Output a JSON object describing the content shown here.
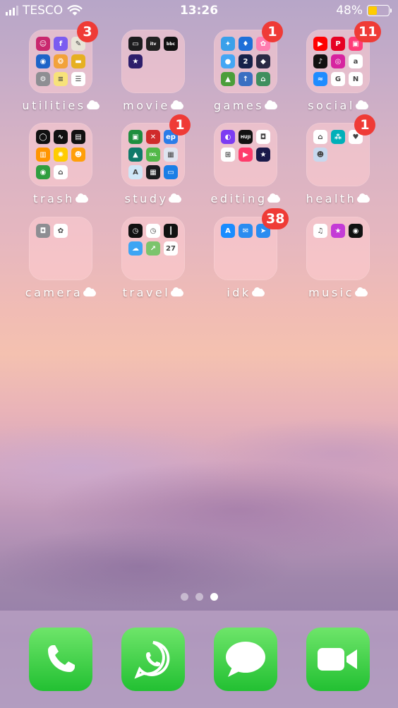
{
  "status": {
    "carrier": "TESCO",
    "time": "13:26",
    "battery": "48%",
    "battery_level": 0.48
  },
  "folders": [
    {
      "label": "utilities",
      "badge": "3",
      "apps": [
        {
          "icon": "santa-icon",
          "bg": "#c9286e",
          "glyph": "☺"
        },
        {
          "icon": "fonts-icon",
          "bg": "#7b5cf0",
          "glyph": "f"
        },
        {
          "icon": "notes-pencil-icon",
          "bg": "#e8e4d8",
          "glyph": "✎"
        },
        {
          "icon": "ring-icon",
          "bg": "#1e64c8",
          "glyph": "◉"
        },
        {
          "icon": "fontmaker-icon",
          "bg": "#f2a23a",
          "glyph": "❂"
        },
        {
          "icon": "wallet-gold-icon",
          "bg": "#e6b022",
          "glyph": "▬"
        },
        {
          "icon": "settings-icon",
          "bg": "#8e8e93",
          "glyph": "⚙"
        },
        {
          "icon": "notes-icon",
          "bg": "#f7e27a",
          "glyph": "≡"
        },
        {
          "icon": "reminders-icon",
          "bg": "#ffffff",
          "glyph": "☰"
        }
      ]
    },
    {
      "label": "movie",
      "badge": "",
      "apps": [
        {
          "icon": "tv-icon",
          "bg": "#1c1c1e",
          "glyph": "▭"
        },
        {
          "icon": "itv-icon",
          "bg": "#222222",
          "glyph": "itv"
        },
        {
          "icon": "bbc-iplayer-icon",
          "bg": "#111111",
          "glyph": "bbc"
        },
        {
          "icon": "imovie-icon",
          "bg": "#2d1e6b",
          "glyph": "★"
        }
      ]
    },
    {
      "label": "games",
      "badge": "1",
      "apps": [
        {
          "icon": "sky-game-icon",
          "bg": "#3aa0ea",
          "glyph": "✦"
        },
        {
          "icon": "game-blue-icon",
          "bg": "#1f6fd8",
          "glyph": "♦"
        },
        {
          "icon": "game-pink-icon",
          "bg": "#ff7db0",
          "glyph": "✿"
        },
        {
          "icon": "balloon-game-icon",
          "bg": "#45a6f4",
          "glyph": "●"
        },
        {
          "icon": "piano-tiles-icon",
          "bg": "#15224a",
          "glyph": "2"
        },
        {
          "icon": "cube-game-icon",
          "bg": "#2a2a44",
          "glyph": "◆"
        },
        {
          "icon": "temple-game-icon",
          "bg": "#4b9e3a",
          "glyph": "▲"
        },
        {
          "icon": "road-game-icon",
          "bg": "#3a6fc2",
          "glyph": "↑"
        },
        {
          "icon": "house-game-icon",
          "bg": "#3f8f5e",
          "glyph": "⌂"
        }
      ]
    },
    {
      "label": "social",
      "badge": "11",
      "apps": [
        {
          "icon": "youtube-icon",
          "bg": "#ff0000",
          "glyph": "▶"
        },
        {
          "icon": "pinterest-icon",
          "bg": "#e60023",
          "glyph": "P"
        },
        {
          "icon": "pink-app-icon",
          "bg": "#ff3c78",
          "glyph": "▣"
        },
        {
          "icon": "tiktok-icon",
          "bg": "#111111",
          "glyph": "♪"
        },
        {
          "icon": "instagram-icon",
          "bg": "#d6249f",
          "glyph": "◎"
        },
        {
          "icon": "amazon-icon",
          "bg": "#ffffff",
          "glyph": "a"
        },
        {
          "icon": "messenger-icon",
          "bg": "#1f8cff",
          "glyph": "≈"
        },
        {
          "icon": "google-icon",
          "bg": "#ffffff",
          "glyph": "G"
        },
        {
          "icon": "news-icon",
          "bg": "#ffffff",
          "glyph": "N"
        }
      ]
    },
    {
      "label": "trash",
      "badge": "",
      "apps": [
        {
          "icon": "watch-icon",
          "bg": "#111111",
          "glyph": "◯"
        },
        {
          "icon": "stocks-icon",
          "bg": "#111111",
          "glyph": "∿"
        },
        {
          "icon": "wallet-icon",
          "bg": "#111111",
          "glyph": "▤"
        },
        {
          "icon": "books-icon",
          "bg": "#ff9500",
          "glyph": "▥"
        },
        {
          "icon": "tips-icon",
          "bg": "#ffcc00",
          "glyph": "✺"
        },
        {
          "icon": "family-icon",
          "bg": "#ff9f0a",
          "glyph": "☻"
        },
        {
          "icon": "find-my-icon",
          "bg": "#2f9e3f",
          "glyph": "◉"
        },
        {
          "icon": "home-icon",
          "bg": "#ffffff",
          "glyph": "⌂"
        }
      ]
    },
    {
      "label": "study",
      "badge": "1",
      "apps": [
        {
          "icon": "classroom-icon",
          "bg": "#1e8e3e",
          "glyph": "▣"
        },
        {
          "icon": "flashcards-icon",
          "bg": "#d02b2b",
          "glyph": "✕"
        },
        {
          "icon": "ep-icon",
          "bg": "#2b7de9",
          "glyph": "ep"
        },
        {
          "icon": "graduation-icon",
          "bg": "#0f7a6a",
          "glyph": "▲"
        },
        {
          "icon": "ixl-icon",
          "bg": "#52b848",
          "glyph": "IXL"
        },
        {
          "icon": "grid-app-icon",
          "bg": "#dfe4ef",
          "glyph": "▦"
        },
        {
          "icon": "translate-icon",
          "bg": "#cfe6f7",
          "glyph": "A"
        },
        {
          "icon": "calculator-icon",
          "bg": "#1c1c1e",
          "glyph": "▦"
        },
        {
          "icon": "files-icon",
          "bg": "#1a7ee6",
          "glyph": "▭"
        }
      ]
    },
    {
      "label": "editing",
      "badge": "",
      "apps": [
        {
          "icon": "gradient-app-icon",
          "bg": "#7d3cf2",
          "glyph": "◐"
        },
        {
          "icon": "huji-icon",
          "bg": "#111111",
          "glyph": "HUJI"
        },
        {
          "icon": "screenshot-icon",
          "bg": "#ffffff",
          "glyph": "◘"
        },
        {
          "icon": "layout-icon",
          "bg": "#ffffff",
          "glyph": "⊞"
        },
        {
          "icon": "video-editor-icon",
          "bg": "#ff3b6b",
          "glyph": "▶"
        },
        {
          "icon": "star-editor-icon",
          "bg": "#1a1a4a",
          "glyph": "★"
        }
      ]
    },
    {
      "label": "health",
      "badge": "1",
      "apps": [
        {
          "icon": "google-home-icon",
          "bg": "#ffffff",
          "glyph": "⌂"
        },
        {
          "icon": "fitbit-icon",
          "bg": "#00b0b9",
          "glyph": "⁂"
        },
        {
          "icon": "health-icon",
          "bg": "#ffffff",
          "glyph": "♥"
        },
        {
          "icon": "sleep-icon",
          "bg": "#c7d8ee",
          "glyph": "☻"
        }
      ]
    },
    {
      "label": "camera",
      "badge": "",
      "apps": [
        {
          "icon": "camera-icon",
          "bg": "#8e8e93",
          "glyph": "◘"
        },
        {
          "icon": "photos-icon",
          "bg": "#ffffff",
          "glyph": "✿"
        }
      ]
    },
    {
      "label": "travel",
      "badge": "",
      "apps": [
        {
          "icon": "clock-icon",
          "bg": "#111111",
          "glyph": "◷"
        },
        {
          "icon": "clock-white-icon",
          "bg": "#ffffff",
          "glyph": "◷"
        },
        {
          "icon": "voice-memos-icon",
          "bg": "#111111",
          "glyph": "┃"
        },
        {
          "icon": "weather-icon",
          "bg": "#3da5f4",
          "glyph": "☁"
        },
        {
          "icon": "maps-icon",
          "bg": "#7cc46c",
          "glyph": "↗"
        },
        {
          "icon": "calendar-icon",
          "bg": "#ffffff",
          "glyph": "27"
        }
      ]
    },
    {
      "label": "idk",
      "badge": "38",
      "apps": [
        {
          "icon": "app-store-icon",
          "bg": "#1a8cff",
          "glyph": "A"
        },
        {
          "icon": "mail-icon",
          "bg": "#2a8cf0",
          "glyph": "✉"
        },
        {
          "icon": "safari-icon",
          "bg": "#2a8cf0",
          "glyph": "➤"
        }
      ]
    },
    {
      "label": "music",
      "badge": "",
      "apps": [
        {
          "icon": "music-icon",
          "bg": "#ffffff",
          "glyph": "♫"
        },
        {
          "icon": "itunes-star-icon",
          "bg": "#c43bd6",
          "glyph": "★"
        },
        {
          "icon": "spotify-icon",
          "bg": "#111111",
          "glyph": "◉"
        }
      ]
    }
  ],
  "page_dots": {
    "count": 3,
    "active": 2
  },
  "dock": [
    {
      "name": "phone",
      "icon": "phone-icon"
    },
    {
      "name": "whatsapp",
      "icon": "whatsapp-icon"
    },
    {
      "name": "messages",
      "icon": "messages-icon"
    },
    {
      "name": "facetime",
      "icon": "facetime-icon"
    }
  ]
}
